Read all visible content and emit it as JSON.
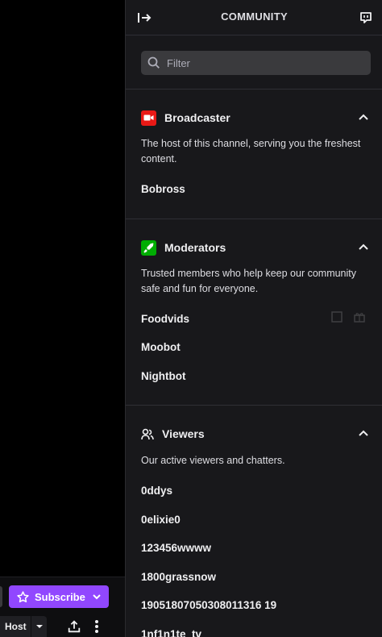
{
  "stream": {
    "subscribe_label": "Subscribe",
    "host_label": "Host"
  },
  "community": {
    "title": "COMMUNITY",
    "filter_placeholder": "Filter",
    "broadcaster": {
      "title": "Broadcaster",
      "description": "The host of this channel, serving you the freshest content.",
      "users": [
        "Bobross"
      ]
    },
    "moderators": {
      "title": "Moderators",
      "description": "Trusted members who help keep our community safe and fun for everyone.",
      "users": [
        "Foodvids",
        "Moobot",
        "Nightbot"
      ]
    },
    "viewers": {
      "title": "Viewers",
      "description": "Our active viewers and chatters.",
      "users": [
        "0ddys",
        "0elixie0",
        "123456wwww",
        "1800grassnow",
        "19051807050308011316 19",
        "1nf1n1te_tv"
      ]
    }
  },
  "colors": {
    "subscribe": "#9147ff",
    "broadcaster_badge": "#e91916",
    "moderator_badge": "#00ad03",
    "panel_bg": "#18181b"
  }
}
